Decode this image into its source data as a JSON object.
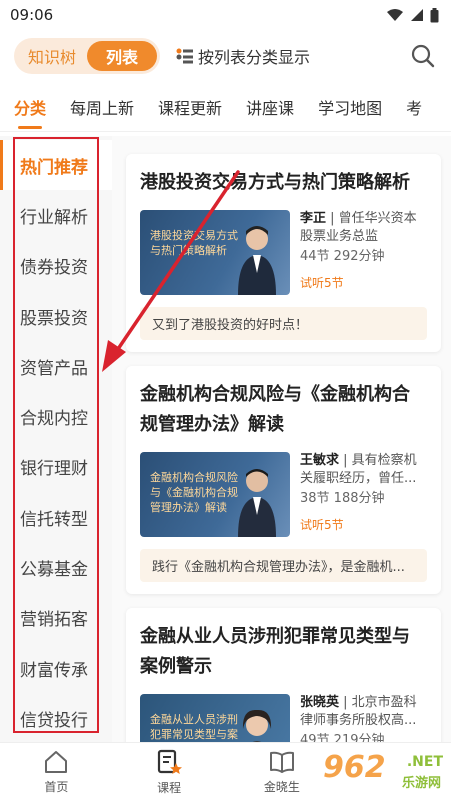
{
  "status": {
    "time": "09:06"
  },
  "topbar": {
    "toggle": [
      "知识树",
      "列表"
    ],
    "hint": "按列表分类显示"
  },
  "tabs": [
    "分类",
    "每周上新",
    "课程更新",
    "讲座课",
    "学习地图",
    "考"
  ],
  "sidebar": [
    "热门推荐",
    "行业解析",
    "债券投资",
    "股票投资",
    "资管产品",
    "合规内控",
    "银行理财",
    "信托转型",
    "公募基金",
    "营销拓客",
    "财富传承",
    "信贷投行"
  ],
  "courses": [
    {
      "title": "港股投资交易方式与热门策略解析",
      "thumb_text": "港股投资交易方式与热门策略解析",
      "teacher": "李正",
      "teacher_desc": "曾任华兴资本股票业务总监",
      "stats": "44节 292分钟",
      "trial": "试听5节",
      "desc": "又到了港股投资的好时点！"
    },
    {
      "title": "金融机构合规风险与《金融机构合规管理办法》解读",
      "thumb_text": "金融机构合规风险与《金融机构合规管理办法》解读",
      "teacher": "王敏求",
      "teacher_desc": "具有检察机关履职经历，曾任...",
      "stats": "38节 188分钟",
      "trial": "试听5节",
      "desc": "践行《金融机构合规管理办法》，是金融机..."
    },
    {
      "title": "金融从业人员涉刑犯罪常见类型与案例警示",
      "thumb_text": "金融从业人员涉刑犯罪常见类型与案例警示",
      "teacher": "张晓英",
      "teacher_desc": "北京市盈科律师事务所股权高...",
      "stats": "49节 219分钟",
      "trial": "",
      "desc": ""
    }
  ],
  "bottom_nav": [
    "首页",
    "课程",
    "金晓生"
  ],
  "watermark": {
    "big": "962",
    "net": ".NET",
    "sub": "乐游网"
  },
  "colors": {
    "accent": "#f07a1a",
    "highlight_box": "#d9232e"
  }
}
